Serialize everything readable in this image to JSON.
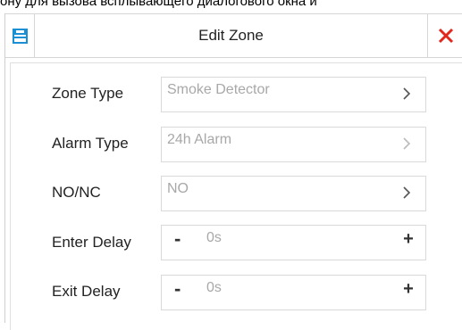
{
  "background_caption": "ону для вызова всплывающего диалогового окна и",
  "dialog": {
    "title": "Edit Zone",
    "save_icon": "save-icon",
    "close_icon": "close-icon",
    "accent_color": "#1a8fd4",
    "close_color": "#e0281e"
  },
  "fields": {
    "zone_type": {
      "label": "Zone Type",
      "value": "Smoke Detector"
    },
    "alarm_type": {
      "label": "Alarm Type",
      "value": "24h Alarm"
    },
    "no_nc": {
      "label": "NO/NC",
      "value": "NO"
    },
    "enter_delay": {
      "label": "Enter Delay",
      "value": "0s",
      "minus": "-",
      "plus": "+"
    },
    "exit_delay": {
      "label": "Exit Delay",
      "value": "0s",
      "minus": "-",
      "plus": "+"
    }
  }
}
